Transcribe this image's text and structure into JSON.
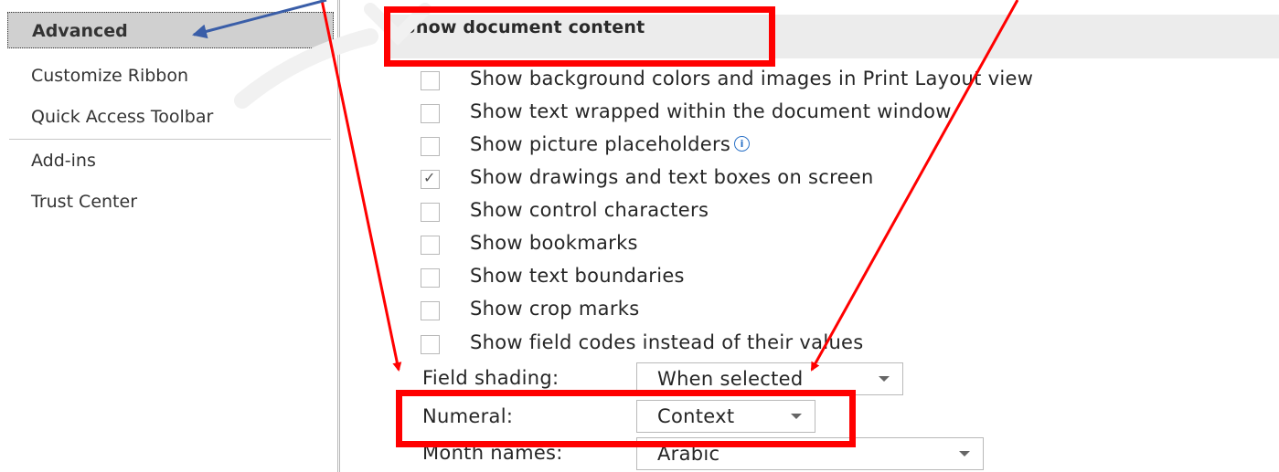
{
  "sidebar": {
    "items": [
      {
        "label": "Advanced",
        "selected": true
      },
      {
        "label": "Customize Ribbon"
      },
      {
        "label": "Quick Access Toolbar"
      },
      {
        "label": "Add-ins"
      },
      {
        "label": "Trust Center"
      }
    ]
  },
  "section": {
    "title": "Show document content"
  },
  "options": [
    {
      "label": "Show background colors and images in Print Layout view",
      "checked": false
    },
    {
      "label": "Show text wrapped within the document window",
      "checked": false
    },
    {
      "label": "Show picture placeholders",
      "checked": false
    },
    {
      "label": "Show drawings and text boxes on screen",
      "checked": true
    },
    {
      "label": "Show control characters",
      "checked": false
    },
    {
      "label": "Show bookmarks",
      "checked": false
    },
    {
      "label": "Show text boundaries",
      "checked": false
    },
    {
      "label": "Show crop marks",
      "checked": false
    },
    {
      "label": "Show field codes instead of their values",
      "checked": false
    }
  ],
  "field_shading": {
    "label": "Field shading:",
    "value": "When selected"
  },
  "numeral": {
    "label": "Numeral:",
    "value": "Context"
  },
  "month_names": {
    "label": "Month names:",
    "value": "Arabic"
  },
  "colors": {
    "highlight": "#ff0000",
    "arrow_blue": "#3a5ea8",
    "selected_bg": "#d0d0d0"
  }
}
